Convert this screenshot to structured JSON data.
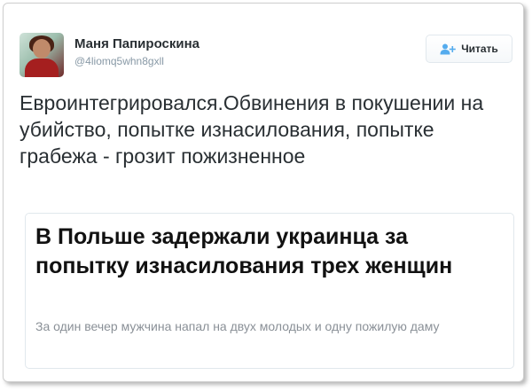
{
  "tweet": {
    "author_name": "Маня Папироскина",
    "author_handle": "@4liomq5whn8gxll",
    "follow_label": "Читать",
    "text": "Евроинтегрировался.Обвинения в покушении на убийство, попытке изнасилования, попытке грабежа - грозит пожизненное"
  },
  "card": {
    "title": "В Польше задержали украинца за попытку изнасилования трех женщин",
    "description": "За один вечер мужчина напал на двух молодых и одну пожилую даму"
  },
  "icons": {
    "avatar": "profile-photo",
    "follow": "person-add-icon"
  },
  "colors": {
    "text": "#292f33",
    "muted": "#8899a6",
    "follow_icon": "#55acee"
  }
}
